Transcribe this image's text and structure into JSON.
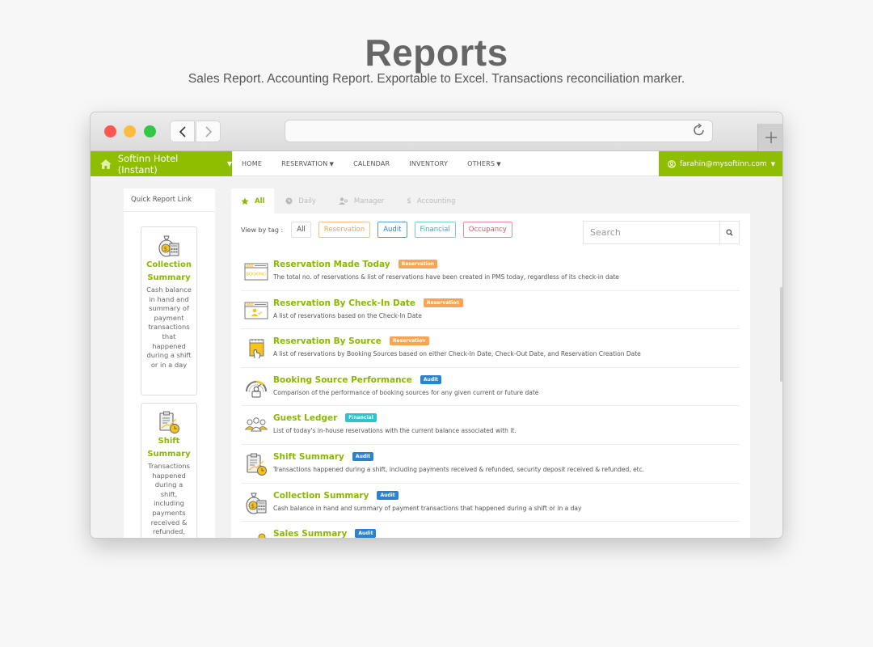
{
  "hero": {
    "title": "Reports",
    "subtitle": "Sales Report. Accounting Report. Exportable to Excel. Transactions reconciliation marker."
  },
  "browser": {
    "back_icon": "chevron-left-icon",
    "forward_icon": "chevron-right-icon",
    "reload_icon": "reload-icon",
    "new_tab_icon": "plus-icon",
    "url": ""
  },
  "nav": {
    "brand": "Softinn Hotel (Instant)",
    "brand_icon": "home-icon",
    "menu": [
      {
        "label": "HOME",
        "dropdown": false
      },
      {
        "label": "RESERVATION",
        "dropdown": true
      },
      {
        "label": "CALENDAR",
        "dropdown": false
      },
      {
        "label": "INVENTORY",
        "dropdown": false
      },
      {
        "label": "OTHERS",
        "dropdown": true
      }
    ],
    "user": "farahin@mysoftinn.com",
    "user_icon": "user-circle-icon",
    "accent_color": "#8fbe00"
  },
  "sidebar": {
    "title": "Quick Report Link",
    "cards": [
      {
        "title": "Collection Summary",
        "description": "Cash balance in hand and summary of payment transactions that happened during a shift or in a day",
        "icon": "money-bag-calculator-icon"
      },
      {
        "title": "Shift Summary",
        "description": "Transactions happened during a shift, including payments received & refunded, security deposit received & refunded, etc.",
        "icon": "clipboard-clock-icon"
      }
    ]
  },
  "tabs": [
    {
      "label": "All",
      "icon": "star-icon",
      "active": true
    },
    {
      "label": "Daily",
      "icon": "clock-icon",
      "active": false
    },
    {
      "label": "Manager",
      "icon": "users-icon",
      "active": false
    },
    {
      "label": "Accounting",
      "icon": "dollar-icon",
      "active": false
    }
  ],
  "filter": {
    "label": "View by tag :",
    "tags": [
      "All",
      "Reservation",
      "Audit",
      "Financial",
      "Occupancy"
    ]
  },
  "search": {
    "placeholder": "Search",
    "value": "",
    "icon": "search-icon"
  },
  "reports": [
    {
      "title": "Reservation Made Today",
      "tag": "Reservation",
      "description": "The total no. of reservations & list of reservations have been created in PMS today, regardless of its check-in date",
      "icon": "booking-window-icon"
    },
    {
      "title": "Reservation By Check-In Date",
      "tag": "Reservation",
      "description": "A list of reservations based on the Check-In Date",
      "icon": "guest-window-icon"
    },
    {
      "title": "Reservation By Source",
      "tag": "Reservation",
      "description": "A list of reservations by Booking Sources based on either Check-In Date, Check-Out Date, and Reservation Creation Date",
      "icon": "calendar-touch-icon"
    },
    {
      "title": "Booking Source Performance",
      "tag": "Audit",
      "description": "Comparison of the performance of booking sources for any given current or future date",
      "icon": "gauge-icon"
    },
    {
      "title": "Guest Ledger",
      "tag": "Financial",
      "description": "List of today's in-house reservations with the current balance associated with it.",
      "icon": "guests-icon"
    },
    {
      "title": "Shift Summary",
      "tag": "Audit",
      "description": "Transactions happened during a shift, including payments received & refunded, security deposit received & refunded, etc.",
      "icon": "clipboard-clock-icon"
    },
    {
      "title": "Collection Summary",
      "tag": "Audit",
      "description": "Cash balance in hand and summary of payment transactions that happened during a shift or in a day",
      "icon": "money-bag-calculator-icon"
    },
    {
      "title": "Sales Summary",
      "tag": "Audit",
      "description": "",
      "icon": "sales-chart-icon"
    }
  ],
  "colors": {
    "reservation": "#f6a552",
    "audit": "#2b83cf",
    "financial": "#2fc3cc",
    "occupancy": "#e8536a",
    "title_green": "#8ab800"
  }
}
